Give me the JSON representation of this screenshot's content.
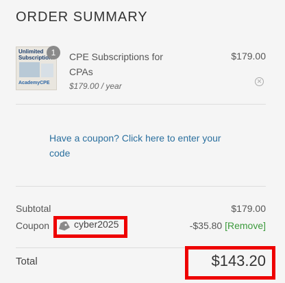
{
  "summary": {
    "title": "ORDER SUMMARY"
  },
  "item": {
    "quantity_badge": "1",
    "thumbnail_text_top": "Unlimited Subscription",
    "thumbnail_text_bottom": "AcademyCPE",
    "name": "CPE Subscriptions for CPAs",
    "price_per": "$179.00 / year",
    "price": "$179.00"
  },
  "coupon_prompt": "Have a coupon? Click here to enter your code",
  "totals": {
    "subtotal_label": "Subtotal",
    "subtotal_value": "$179.00",
    "coupon_label": "Coupon",
    "coupon_code": "cyber2025",
    "coupon_discount": "-$35.80",
    "coupon_remove": "[Remove]",
    "total_label": "Total",
    "total_value": "$143.20"
  },
  "colors": {
    "link": "#2a6f9e",
    "remove": "#3b9a3b",
    "highlight": "#ee0000"
  },
  "icons": {
    "thumbnail": "product-thumbnail-icon",
    "remove_item": "remove-item-icon",
    "coupon": "tag-icon"
  }
}
